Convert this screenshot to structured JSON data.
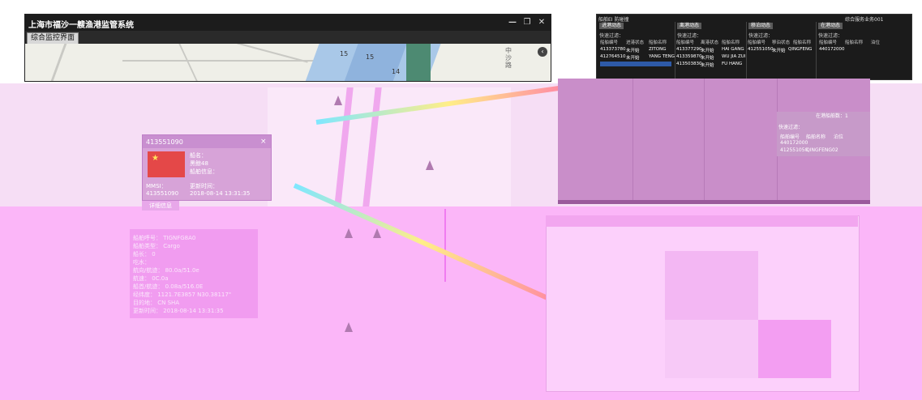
{
  "main_window": {
    "title": "上海市福沙一艘渔港监管系统",
    "tab": "综合监控界面",
    "minimize_symbol": "—",
    "restore_symbol": "❐",
    "close_symbol": "✕",
    "map_depths": [
      "15",
      "15",
      "14"
    ],
    "map_side_button": "‹",
    "map_vertical_text": "中沙路"
  },
  "vessel_popup": {
    "header": "413551090",
    "close_symbol": "×",
    "name_label": "船名：",
    "name_value": "黑鲸48",
    "extra_label": "船舶信息：",
    "mmsi_label": "MMSI：",
    "mmsi_value": "413551090",
    "time_label": "更新时间：",
    "time_value": "2018-08-14 13:31:35",
    "button": "详细信息"
  },
  "vessel_detail": {
    "rows": [
      "船舶呼号：  TIGNFG8A0",
      "船舶类型：  Cargo",
      "船长：     0",
      "吃水：",
      "航向/航迹：  80.0a/51.0e",
      "航速：     0C.0a",
      "船首/航迹：  0.08a/516.0E",
      "经纬度：   1121.7E3857 N30.38117\"",
      "目的地：    CN SHA",
      "更新时间：  2018-08-14 13:31:35"
    ]
  },
  "right_panel": {
    "title_left": "船舶EI 防碰撞",
    "title_right": "综合服务业务001",
    "sections": [
      {
        "header": "进港动态",
        "filter": "快速过滤：",
        "cols": [
          "船舶编号",
          "进港状态",
          "船舶名称"
        ],
        "rows": [
          [
            "413373780",
            "未开始",
            "ZITONG"
          ],
          [
            "412764510",
            "未开始",
            "YANG TENG"
          ]
        ]
      },
      {
        "header": "离港动态",
        "filter": "快速过滤：",
        "cols": [
          "船舶编号",
          "离港状态",
          "船舶名称"
        ],
        "rows": [
          [
            "413377290",
            "未开始",
            "HAI GANG"
          ],
          [
            "413359870",
            "未开始",
            "WU JIA ZUI"
          ],
          [
            "413503830",
            "未开始",
            "FU HANG"
          ]
        ]
      },
      {
        "header": "移泊动态",
        "filter": "快速过滤：",
        "cols": [
          "船舶编号",
          "移泊状态",
          "船舶名称"
        ],
        "rows": [
          [
            "412551050",
            "未开始",
            "QINGFENG"
          ]
        ]
      },
      {
        "header": "在港动态",
        "filter": "快速过滤：",
        "cols": [
          "船舶编号",
          "船舶名称",
          "泊位"
        ],
        "rows": [
          [
            "440172000",
            "",
            ""
          ]
        ]
      }
    ]
  },
  "right_small_panel": {
    "title": "在港船舶数：1",
    "filter": "快速过滤：",
    "cols": [
      "船舶编号",
      "船舶名称",
      "泊位"
    ],
    "rows": [
      [
        "440172000",
        "",
        ""
      ],
      [
        "412551050",
        "QINGFENG02",
        ""
      ]
    ]
  }
}
